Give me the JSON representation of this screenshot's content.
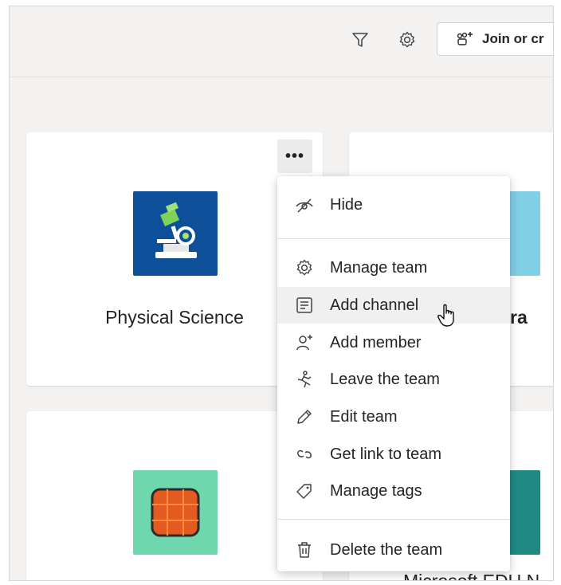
{
  "toolbar": {
    "filter_icon": "filter-icon",
    "settings_icon": "gear-icon",
    "join_label": "Join or cr"
  },
  "cards": [
    {
      "name": "Physical Science",
      "icon": "microscope-icon",
      "tile_color": "#0e4f9a"
    },
    {
      "name": "ora",
      "icon": "calculator-icon",
      "tile_color": "#7fcfe6"
    },
    {
      "name": "",
      "icon": "orange-grid-icon",
      "tile_color": "#6fd7ad"
    },
    {
      "name": "Microsoft EDU N",
      "icon": "teal-tile",
      "tile_color": "#1f8a84"
    }
  ],
  "more_button_label": "•••",
  "menu": {
    "items": [
      {
        "label": "Hide",
        "icon": "hide-icon"
      },
      {
        "label": "Manage team",
        "icon": "gear-icon"
      },
      {
        "label": "Add channel",
        "icon": "channel-icon"
      },
      {
        "label": "Add member",
        "icon": "add-member-icon"
      },
      {
        "label": "Leave the team",
        "icon": "leave-icon"
      },
      {
        "label": "Edit team",
        "icon": "pencil-icon"
      },
      {
        "label": "Get link to team",
        "icon": "link-icon"
      },
      {
        "label": "Manage tags",
        "icon": "tag-icon"
      },
      {
        "label": "Delete the team",
        "icon": "trash-icon"
      }
    ],
    "hovered_item": "Add channel"
  }
}
